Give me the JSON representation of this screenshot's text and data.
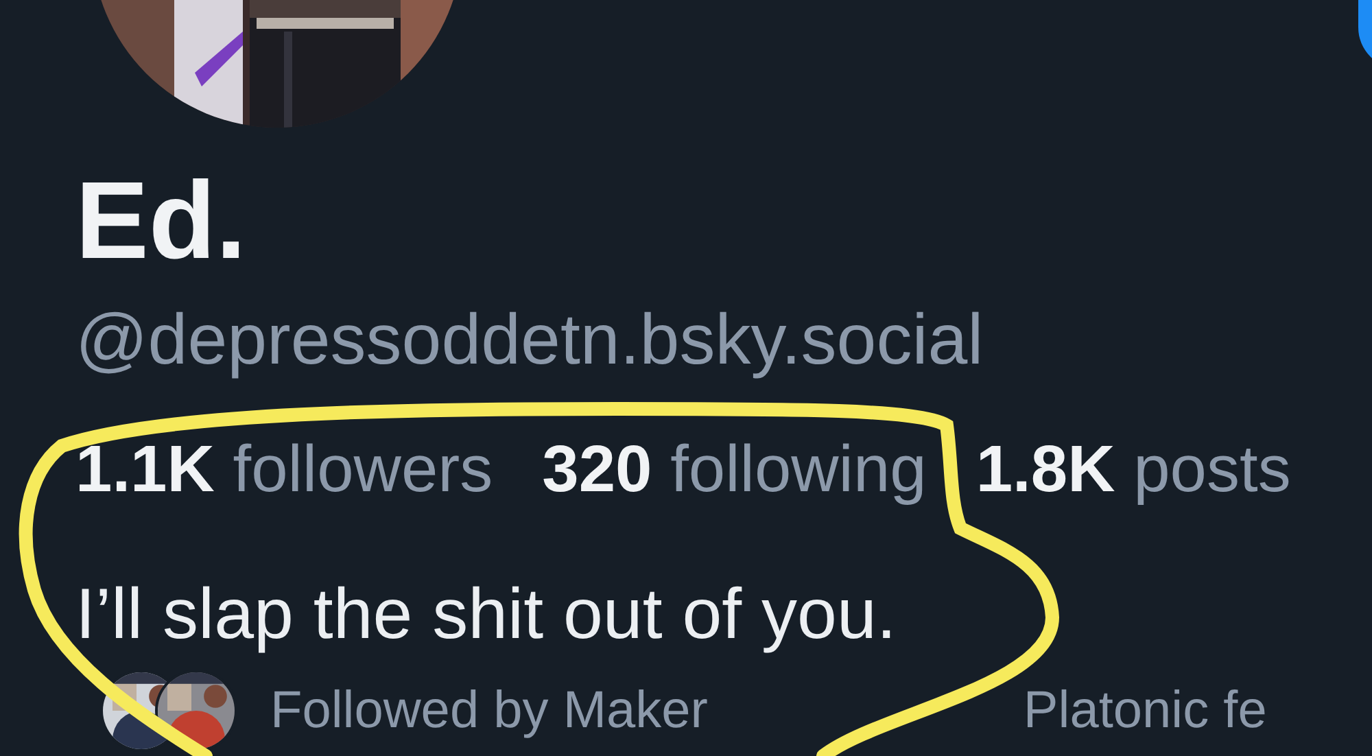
{
  "profile": {
    "display_name": "Ed.",
    "handle": "@depressoddetn.bsky.social",
    "stats": [
      {
        "count": "1.1K",
        "label": "followers"
      },
      {
        "count": "320",
        "label": "following"
      },
      {
        "count": "1.8K",
        "label": "posts"
      }
    ],
    "bio": "I’ll slap the shit out of you.",
    "followed_by": [
      "Followed by Maker",
      "Platonic fe"
    ]
  }
}
